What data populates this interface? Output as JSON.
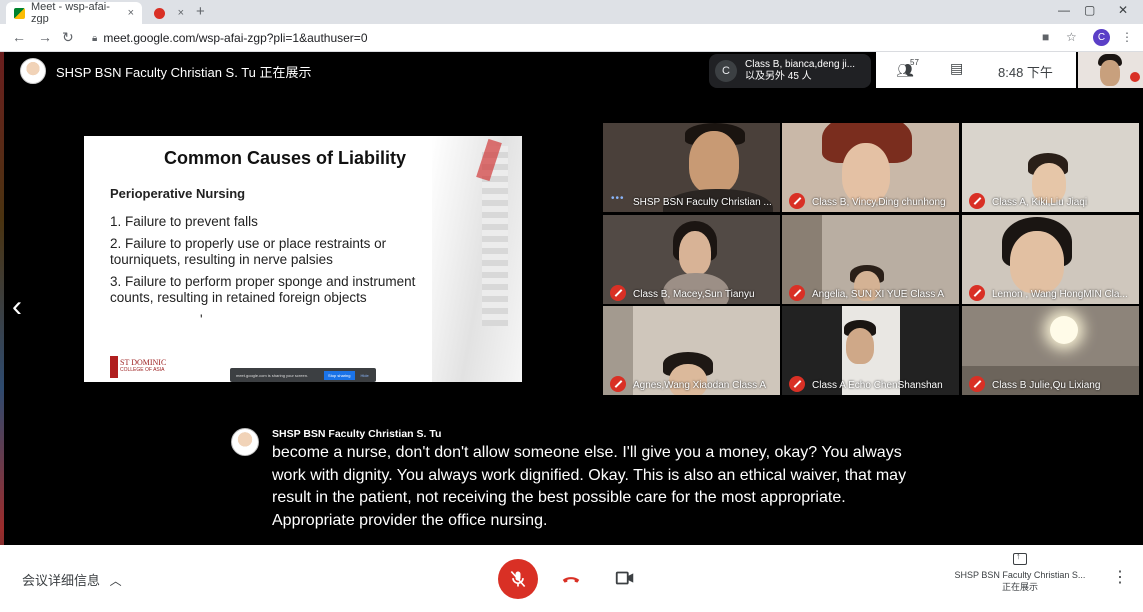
{
  "browser": {
    "tabs": [
      {
        "title": "Meet - wsp-afai-zgp",
        "close": "×"
      },
      {
        "title": "",
        "close": "×"
      }
    ],
    "new_tab": "+",
    "window_controls": [
      "—",
      "▢",
      "✕"
    ],
    "url": "meet.google.com/wsp-afai-zgp?pli=1&authuser=0",
    "profile_initial": "C",
    "icons": [
      "back-arrow-icon",
      "forward-arrow-icon",
      "reload-icon",
      "lock-icon",
      "camera-icon",
      "star-icon",
      "menu-dots-icon"
    ]
  },
  "meet_header": {
    "presenter_label": "SHSP BSN Faculty Christian S. Tu 正在展示",
    "chat_preview": {
      "initial": "C",
      "line1": "Class B, bianca,deng ji...",
      "line2": "以及另外 45 人"
    },
    "people_count": "57",
    "time": "8:48 下午"
  },
  "slide": {
    "title": "Common Causes of Liability",
    "subtitle": "Perioperative Nursing",
    "items": [
      "1. Failure to prevent falls",
      "2. Failure to properly use or place restraints or tourniquets, resulting in nerve palsies",
      "3. Failure to perform proper sponge and instrument counts, resulting in retained foreign objects"
    ],
    "bullet": "'",
    "logo_line1": "ST DOMINIC",
    "logo_line2": "COLLEGE OF ASIA",
    "share_banner": {
      "text": "meet.google.com is sharing your screen.",
      "stop": "Stop sharing",
      "hide": "Hide"
    }
  },
  "participants": [
    {
      "name": "SHSP BSN Faculty Christian ...",
      "muted": false
    },
    {
      "name": "Class B, Vincy,Ding chunhong",
      "muted": true
    },
    {
      "name": "Class A, Kiki,Liu Jiaqi",
      "muted": true
    },
    {
      "name": "Class B, Macey,Sun Tianyu",
      "muted": true
    },
    {
      "name": "Angelia, SUN XI YUE Class A",
      "muted": true
    },
    {
      "name": "Lemon , Wang HongMIN Cla...",
      "muted": true
    },
    {
      "name": "Agnes,Wang Xiaodan Class A",
      "muted": true
    },
    {
      "name": "Class A Echo ChenShanshan",
      "muted": true
    },
    {
      "name": "Class B Julie,Qu Lixiang",
      "muted": true
    }
  ],
  "caption": {
    "speaker": "SHSP BSN Faculty Christian S. Tu",
    "text": "become a nurse, don't don't allow someone else. I'll give you a money, okay? You always work with dignity. You always work dignified. Okay. This is also an ethical waiver, that may result in the patient, not receiving the best possible care for the most appropriate. Appropriate provider the office nursing."
  },
  "bottom_bar": {
    "details_label": "会议详细信息",
    "presenting_name": "SHSP BSN Faculty Christian S...",
    "presenting_status": "正在展示",
    "colors": {
      "mic_red": "#d93025",
      "hangup_red": "#d93025"
    }
  }
}
